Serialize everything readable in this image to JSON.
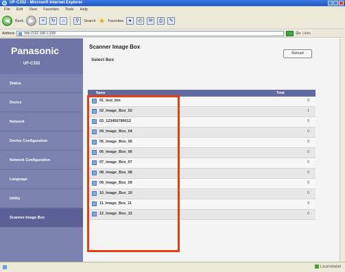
{
  "window": {
    "title": "UF-C332 - Microsoft Internet Explorer"
  },
  "menu": [
    "File",
    "Edit",
    "View",
    "Favorites",
    "Tools",
    "Help"
  ],
  "toolbar": {
    "back_label": "Back",
    "search_label": "Search",
    "favorites_label": "Favorites"
  },
  "address": {
    "label": "Address",
    "url": "http://192.168.1.100/",
    "go_label": "Go",
    "links_label": "Links"
  },
  "brand": {
    "name": "Panasonic",
    "model": "UF-C332"
  },
  "nav": {
    "items": [
      "Status",
      "Device",
      "Network",
      "Device Configuration",
      "Network Configuration",
      "Language",
      "Utility",
      "Scanner Image Box"
    ],
    "active_index": 7
  },
  "main": {
    "title": "Scanner Image Box",
    "subtitle": "Select Box",
    "refresh_label": "Reload",
    "columns": [
      "Name",
      "Total"
    ],
    "rows": [
      {
        "name": "01_test_btn",
        "total": "0"
      },
      {
        "name": "02_Image_Box_02",
        "total": "1"
      },
      {
        "name": "03_123456789012",
        "total": "0"
      },
      {
        "name": "04_Image_Box_04",
        "total": "0"
      },
      {
        "name": "05_Image_Box_05",
        "total": "0"
      },
      {
        "name": "06_Image_Box_06",
        "total": "0"
      },
      {
        "name": "07_Image_Box_07",
        "total": "0"
      },
      {
        "name": "08_Image_Box_08",
        "total": "0"
      },
      {
        "name": "09_Image_Box_09",
        "total": "0"
      },
      {
        "name": "10_Image_Box_10",
        "total": "0"
      },
      {
        "name": "11_Image_Box_11",
        "total": "0"
      },
      {
        "name": "12_Image_Box_12",
        "total": "0"
      }
    ]
  },
  "status": {
    "zone_label": "Local intranet"
  },
  "colors": {
    "highlight": "#e83c13",
    "nav_bg": "#7b82b0",
    "header_bg": "#636aa0"
  }
}
